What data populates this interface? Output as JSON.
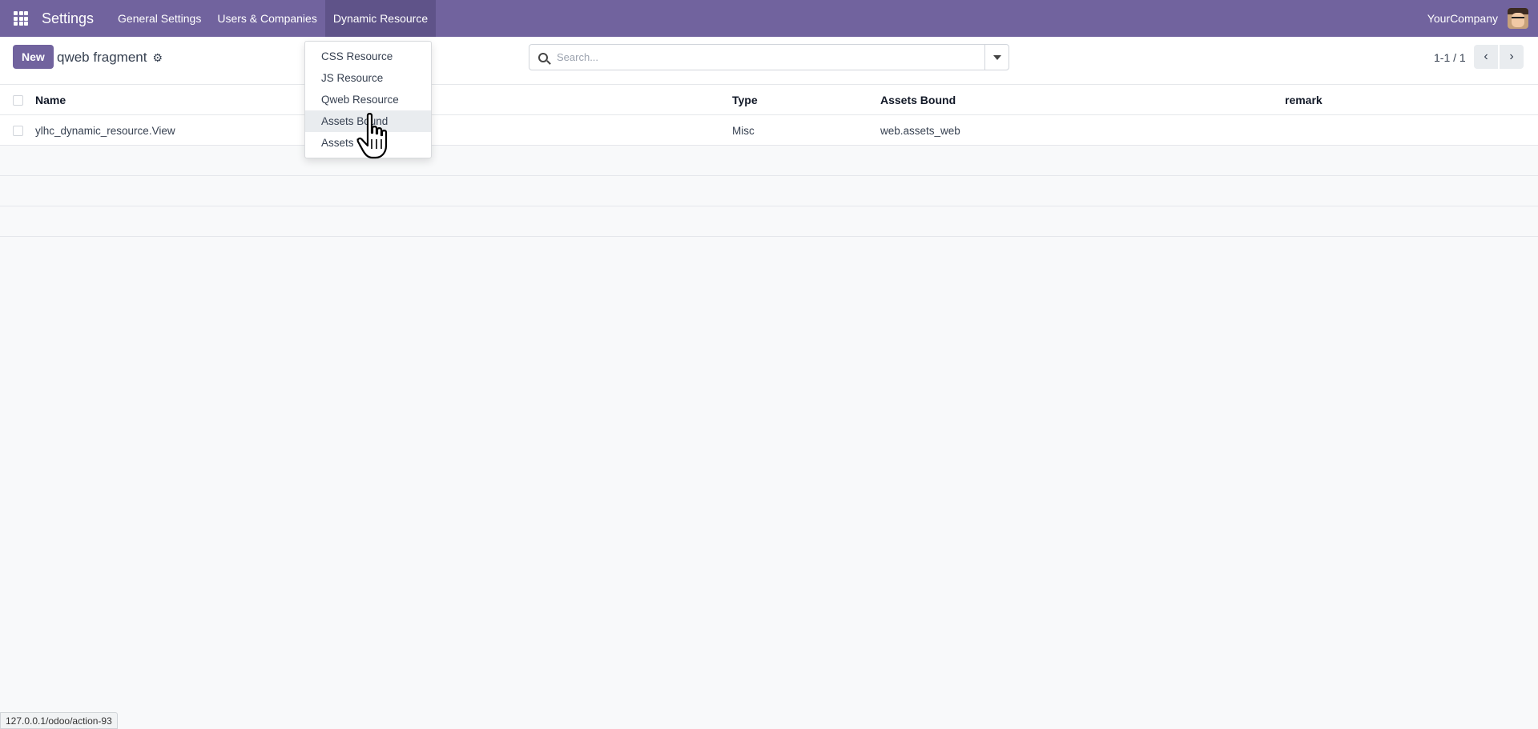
{
  "navbar": {
    "app_name": "Settings",
    "menu": [
      "General Settings",
      "Users & Companies",
      "Dynamic Resource"
    ],
    "company": "YourCompany",
    "icons": {
      "apps": "apps-grid-icon",
      "avatar": "user-avatar"
    },
    "colors": {
      "navbar_bg": "#71639e",
      "active_menu_bg": "#5f5389"
    }
  },
  "control": {
    "new_label": "New",
    "breadcrumb": "qweb fragment",
    "search_placeholder": "Search...",
    "pager": "1-1 / 1"
  },
  "dropdown": {
    "items": [
      "CSS Resource",
      "JS Resource",
      "Qweb Resource",
      "Assets Bound",
      "Assets T"
    ],
    "hovered_item": "Assets Bound"
  },
  "table": {
    "columns": [
      "Name",
      "Type",
      "Assets Bound",
      "remark"
    ],
    "rows": [
      {
        "name": "ylhc_dynamic_resource.View",
        "type": "Misc",
        "assets_bound": "web.assets_web",
        "remark": ""
      }
    ]
  },
  "statusbar": {
    "url": "127.0.0.1/odoo/action-93"
  }
}
